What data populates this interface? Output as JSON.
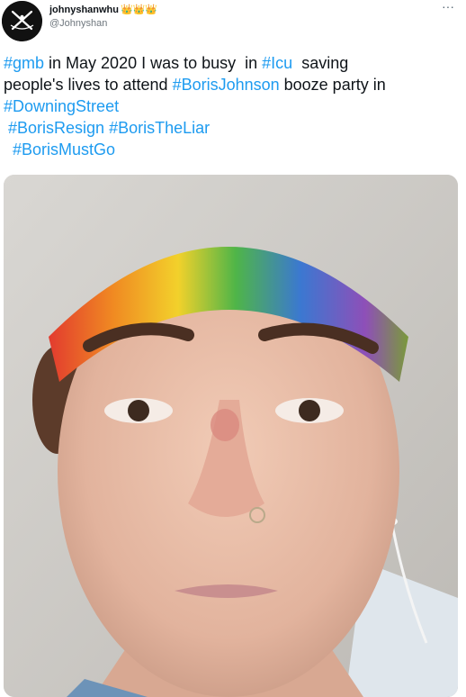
{
  "author": {
    "display_name": "johnyshanwhu",
    "crowns": "👑👑👑",
    "handle": "@Johnyshan",
    "avatar_icon": "avatar-logo-icon"
  },
  "menu": {
    "more_label": "···"
  },
  "tweet": {
    "line1": {
      "tag1": "#gmb",
      "text1": " in May 2020 I was to busy  in ",
      "tag2": "#Icu",
      "text2": "  saving"
    },
    "line2": {
      "text1": "people's lives to attend ",
      "tag1": "#BorisJohnson",
      "text2": " booze party in"
    },
    "line3": {
      "tag1": "#DowningStreet"
    },
    "line4": {
      "lead": " ",
      "tag1": "#BorisResign",
      "text1": " ",
      "tag2": "#BorisTheLiar"
    },
    "line5": {
      "lead": "  ",
      "tag1": "#BorisMustGo"
    }
  },
  "colors": {
    "hashtag": "#1d9bf0",
    "handle": "#6e767d",
    "crown": "#e2a51b"
  }
}
